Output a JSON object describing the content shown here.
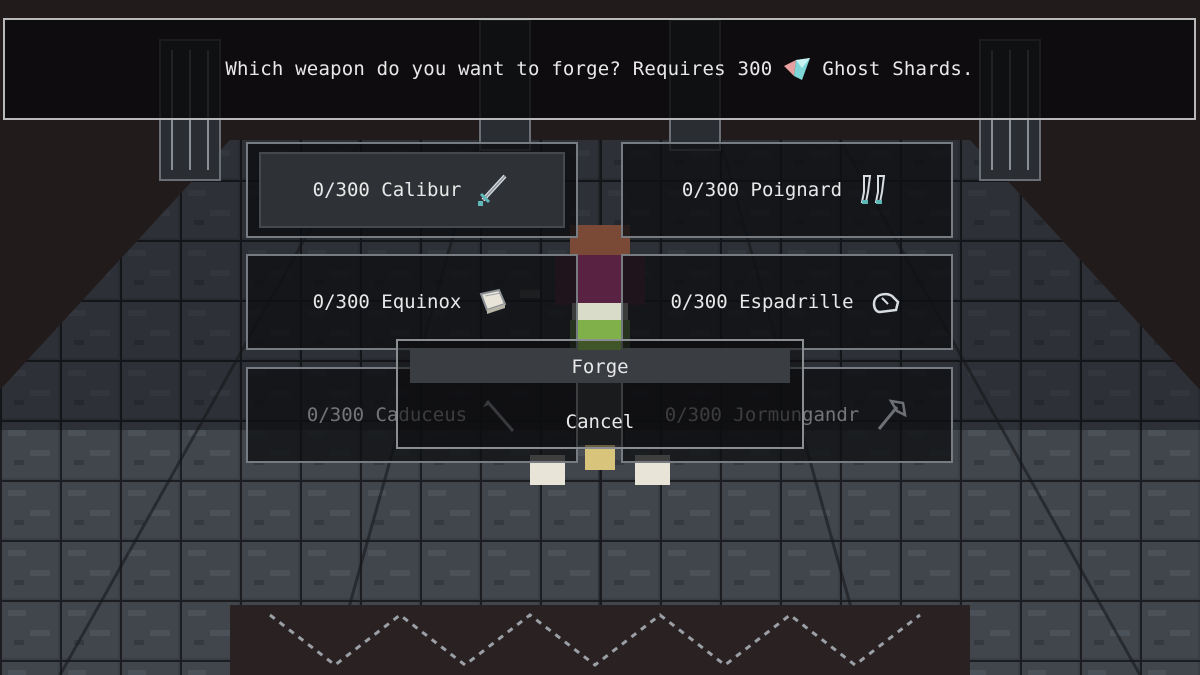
{
  "prompt": {
    "text_before": "Which weapon do you want to forge? Requires 300",
    "text_after": "Ghost Shards."
  },
  "options": [
    {
      "label": "0/300 Calibur",
      "icon": "sword-icon",
      "selected": true
    },
    {
      "label": "0/300 Poignard",
      "icon": "dagger-icon",
      "selected": false
    },
    {
      "label": "0/300 Equinox",
      "icon": "tome-icon",
      "selected": false
    },
    {
      "label": "0/300 Espadrille",
      "icon": "shoe-icon",
      "selected": false
    },
    {
      "label": "0/300 Caduceus",
      "icon": "staff-icon",
      "selected": false
    },
    {
      "label": "0/300 Jormungandr",
      "icon": "axe-icon",
      "selected": false
    }
  ],
  "menu": {
    "forge_label": "Forge",
    "cancel_label": "Cancel"
  },
  "colors": {
    "shard_teal": "#7fd6d6",
    "shard_pink": "#e8a0a0",
    "selected_fill": "#2e3236"
  }
}
